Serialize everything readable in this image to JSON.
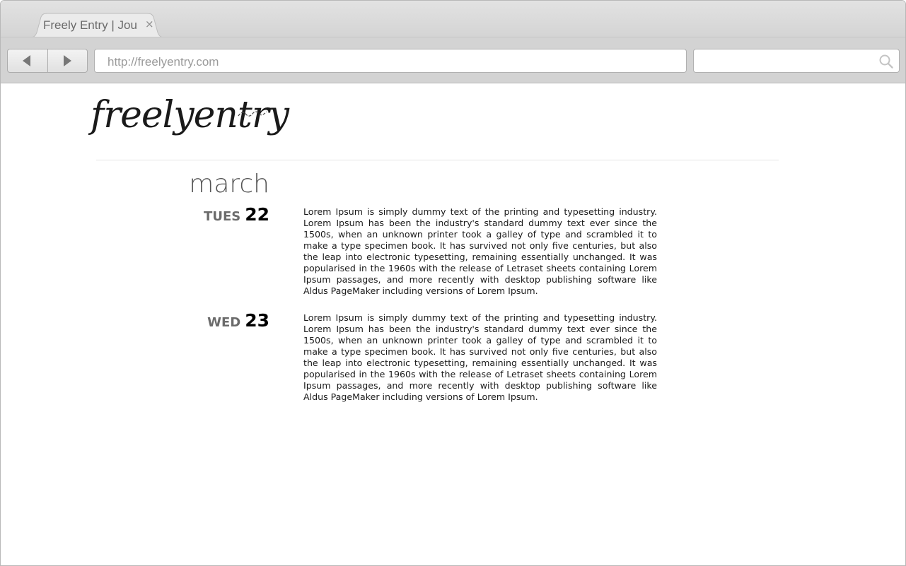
{
  "browser": {
    "tab_title": "Freely Entry | Jou",
    "tab_close": "×",
    "url": "http://freelyentry.com",
    "search_placeholder": ""
  },
  "site": {
    "logo_text": "freelyentry",
    "month": "march"
  },
  "entries": [
    {
      "day": "TUES",
      "date": "22",
      "text": "Lorem Ipsum is simply dummy text of the printing and typesetting industry. Lorem Ipsum has been the industry's standard dummy text ever since the 1500s, when an unknown printer took a galley of type and scrambled it to make a type specimen book. It has survived not only five centuries, but also the leap into electronic typesetting, remaining essentially unchanged. It was popularised in the 1960s with the release of Letraset sheets containing Lorem Ipsum passages, and more recently with desktop publishing software like Aldus PageMaker including versions of Lorem Ipsum."
    },
    {
      "day": "WED",
      "date": "23",
      "text": "Lorem Ipsum is simply dummy text of the printing and typesetting industry. Lorem Ipsum has been the industry's standard dummy text ever since the 1500s, when an unknown printer took a galley of type and scrambled it to make a type specimen book. It has survived not only five centuries, but also the leap into electronic typesetting, remaining essentially unchanged. It was popularised in the 1960s with the release of Letraset sheets containing Lorem Ipsum passages, and more recently with desktop publishing software like Aldus PageMaker including versions of Lorem Ipsum."
    }
  ],
  "icons": {
    "back": "back-arrow-icon",
    "forward": "forward-arrow-icon",
    "search": "search-icon"
  }
}
